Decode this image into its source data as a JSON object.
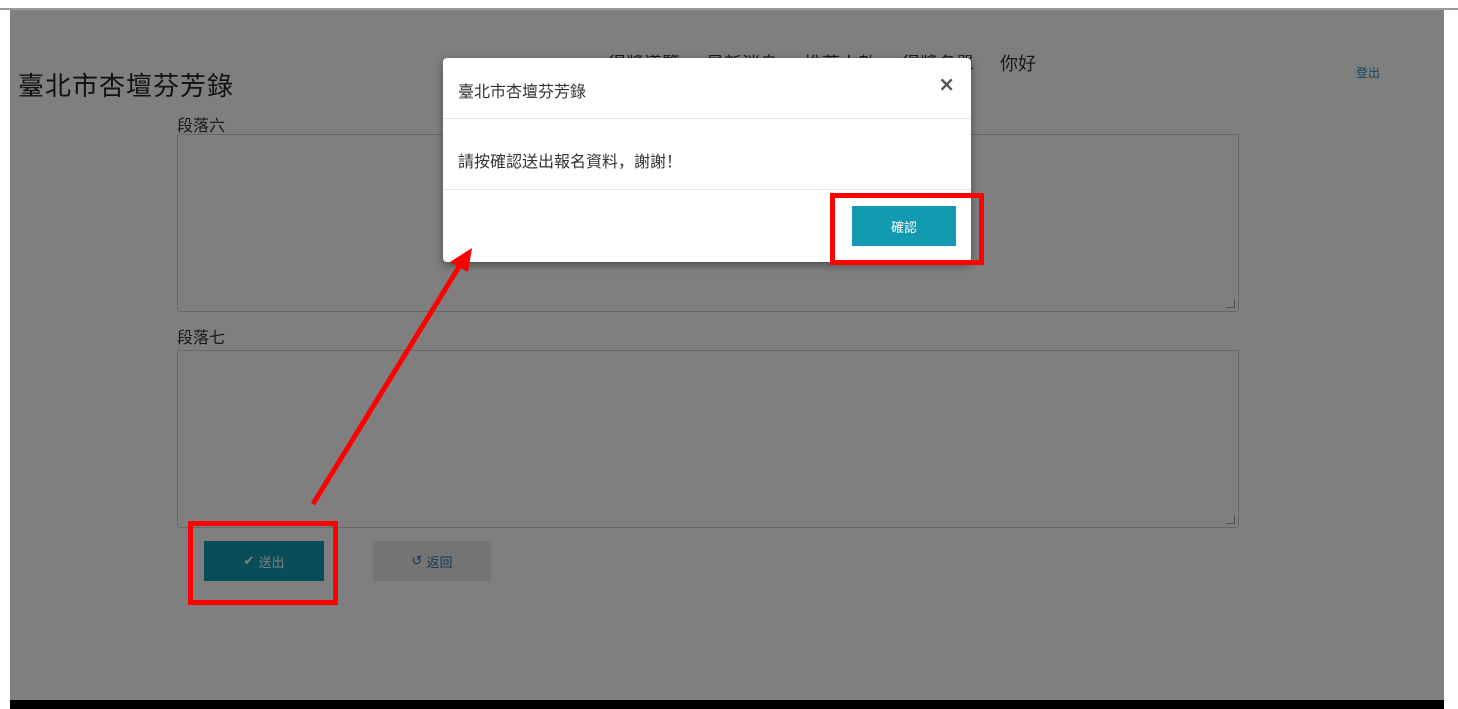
{
  "brand": "臺北市杏壇芬芳錄",
  "nav": {
    "links": [
      "得獎名單",
      "你好"
    ],
    "hidden_links": [
      "得獎導覽",
      "最新消息",
      "推薦人數"
    ],
    "logout": "登出"
  },
  "form": {
    "para6_label": "段落六",
    "para7_label": "段落七",
    "submit_label": "送出",
    "back_label": "返回"
  },
  "modal": {
    "title": "臺北市杏壇芬芳錄",
    "close": "×",
    "message": "請按確認送出報名資料，謝謝！",
    "confirm_label": "確認"
  },
  "colors": {
    "primary": "#129ab0",
    "annotation": "#ff0000"
  },
  "icons": {
    "submit": "check-icon",
    "back": "undo-icon",
    "close": "close-icon"
  }
}
